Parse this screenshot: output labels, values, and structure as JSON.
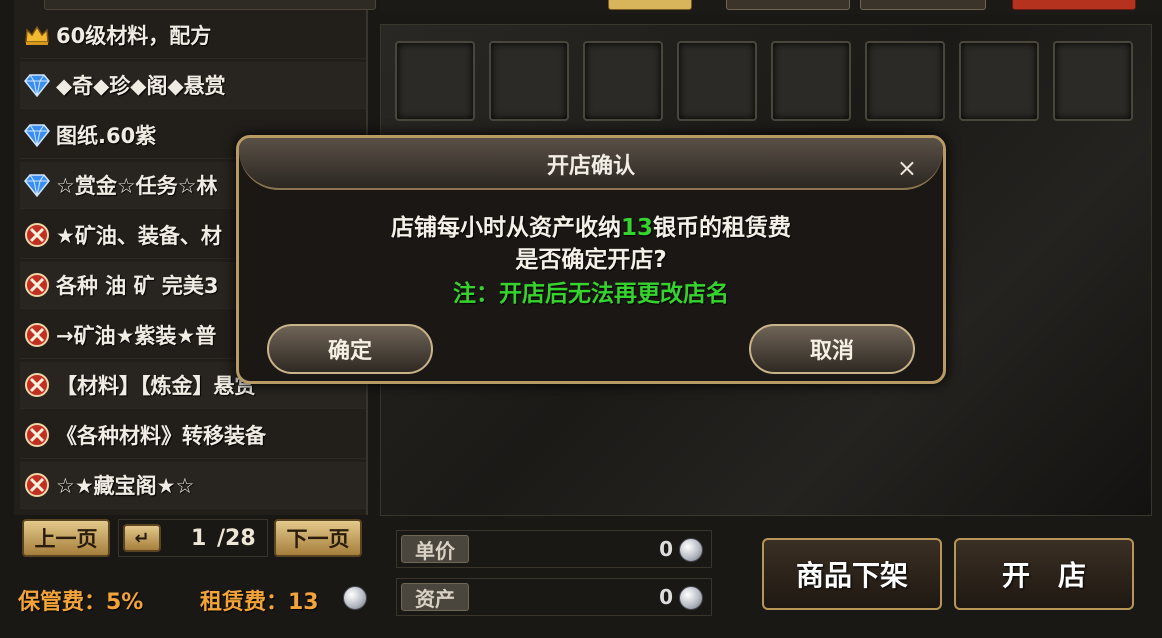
{
  "shop_list": [
    {
      "icon": "crown-icon",
      "name": "60级材料，配方"
    },
    {
      "icon": "diamond-icon",
      "name": "◆奇◆珍◆阁◆悬赏"
    },
    {
      "icon": "diamond-icon",
      "name": "图纸.60紫"
    },
    {
      "icon": "diamond-icon",
      "name": "☆赏金☆任务☆林"
    },
    {
      "icon": "emblem-icon",
      "name": "★矿油、装备、材"
    },
    {
      "icon": "emblem-icon",
      "name": "各种 油 矿 完美3"
    },
    {
      "icon": "emblem-icon",
      "name": "→矿油★紫装★普"
    },
    {
      "icon": "emblem-icon",
      "name": "【材料】【炼金】悬赏"
    },
    {
      "icon": "emblem-icon",
      "name": "《各种材料》转移装备"
    },
    {
      "icon": "emblem-icon",
      "name": "☆★藏宝阁★☆"
    }
  ],
  "pager": {
    "prev_label": "上一页",
    "next_label": "下一页",
    "enter_symbol": "↵",
    "current_page": "1",
    "total_pages": "/28"
  },
  "fees": {
    "storage_fee": "保管费：5%",
    "rent_fee": "租赁费：13"
  },
  "price_fields": [
    {
      "label": "单价",
      "value": "0"
    },
    {
      "label": "资产",
      "value": "0"
    }
  ],
  "actions": {
    "delist_label": "商品下架",
    "open_label": "开　店"
  },
  "modal": {
    "title": "开店确认",
    "close_symbol": "×",
    "line1_prefix": "店铺每小时从资产收纳",
    "line1_amount": "13",
    "line1_suffix": "银币的租赁费",
    "line2": "是否确定开店?",
    "note": "注：开店后无法再更改店名",
    "confirm_label": "确定",
    "cancel_label": "取消"
  },
  "colors": {
    "accent_gold": "#b89a64",
    "fee_orange": "#f2a33a",
    "highlight_green": "#36d32e"
  }
}
